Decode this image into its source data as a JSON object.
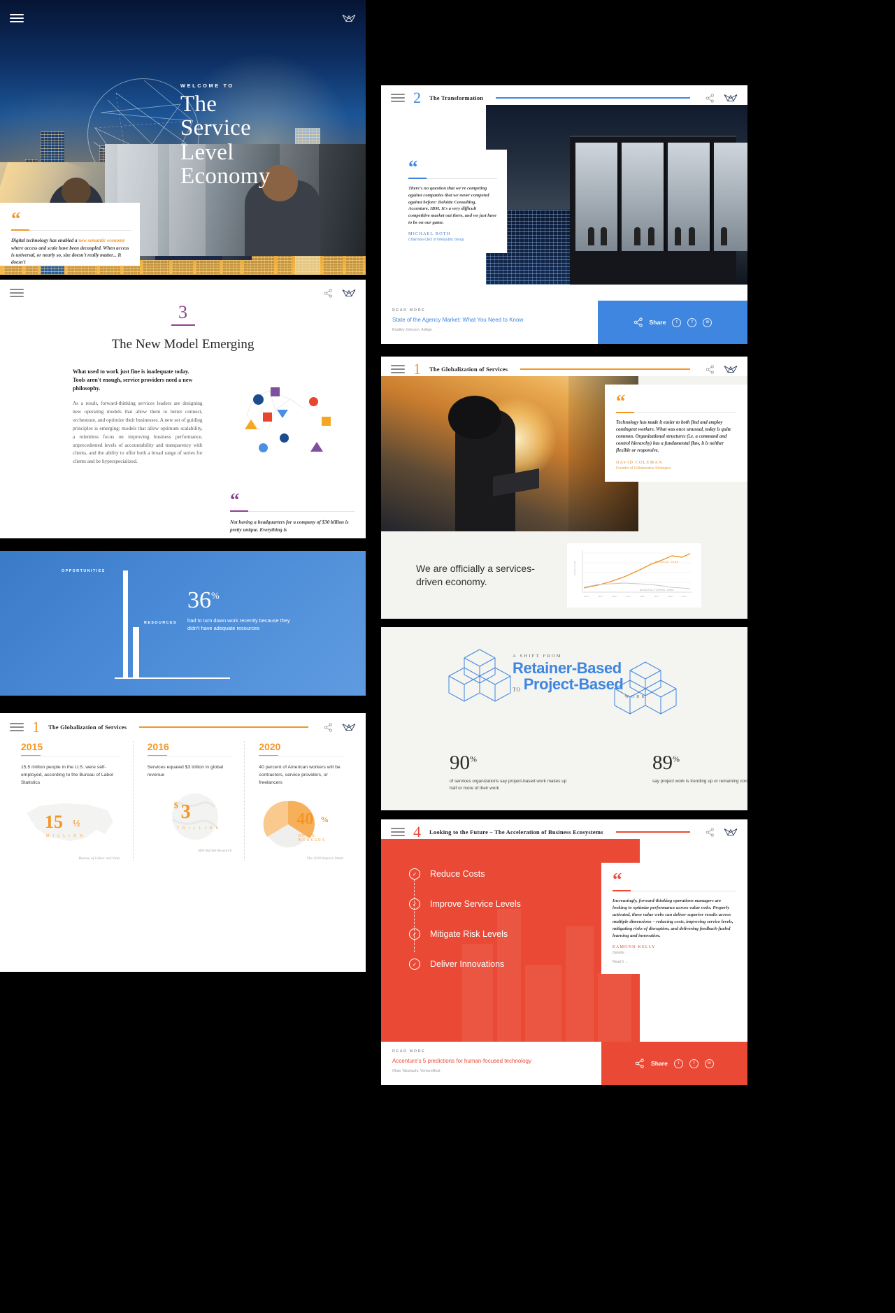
{
  "hero": {
    "welcome": "WELCOME TO",
    "title_lines": [
      "The",
      "Service",
      "Level",
      "Economy"
    ],
    "menu_icon": "hamburger-menu-icon",
    "logo_icon": "mavenlink-logo-icon"
  },
  "new_model": {
    "number": "3",
    "title": "The New Model Emerging",
    "lede": "What used to work just fine is inadequate today. Tools aren't enough, service providers need a new philosophy.",
    "body": "As a result, forward-thinking services leaders are designing new operating models that allow them to better connect, orchestrate, and optimize their businesses. A new set of guiding principles is emerging: models that allow optimum scalability, a relentless focus on improving business performance, unprecedented levels of accountability and transparency with clients, and the ability to offer both a broad range of series for clients and be hyperspecialized.",
    "accent_color": "#8e3f8e",
    "quote": "Not having a headquarters for a company of $30 billion is pretty unique. Everything is"
  },
  "blue_stat": {
    "label_opportunities": "OPPORTUNITIES",
    "label_resources": "RESOURCES",
    "value": "36",
    "unit": "%",
    "description": "had to turn down work recently because they didn't have adequate resources",
    "background_color": "#4a8ad6",
    "chart_data": {
      "type": "bar",
      "categories": [
        "OPPORTUNITIES",
        "RESOURCES"
      ],
      "values": [
        100,
        36
      ],
      "title": "",
      "xlabel": "",
      "ylabel": "",
      "ylim": [
        0,
        100
      ]
    }
  },
  "timeline": {
    "number": "1",
    "section_title": "The Globalization of Services",
    "accent_color": "#f59524",
    "columns": [
      {
        "year": "2015",
        "desc": "15.5 million people in the U.S. were self-employed, according to the Bureau of Labor Statistics",
        "viz_number": "15",
        "viz_fraction": "½",
        "viz_sub": "M I L L I O N",
        "source": "Bureau of Labor and Stats"
      },
      {
        "year": "2016",
        "desc": "Services equaled $3 trillion in global revenue",
        "viz_number": "3",
        "viz_prefix": "$",
        "viz_sub": "T R I L L I O N",
        "source": "IBA Market Research"
      },
      {
        "year": "2020",
        "desc": "40 percent of American workers will be contractors, service providers, or freelancers",
        "viz_number": "40",
        "viz_unit": "%",
        "viz_sub": "OF US WORKERS",
        "source": "The 2020 Report, Intuit"
      }
    ],
    "quote_pre": "Digital technology has enabled a ",
    "quote_highlight": "new semantic economy",
    "quote_post": " where access and scale have been decoupled. When access is universal, or nearly so, size doesn't really matter... It doesn't"
  },
  "transformation": {
    "number": "2",
    "section_title": "The Transformation",
    "accent_color": "#3f86e0",
    "quote": "There's no question that we're competing against companies that we never competed against before: Deloitte Consulting, Accenture, IBM. It's a very difficult competitive market out there, and we just have to be on our game.",
    "author": "MICHAEL ROTH",
    "author_role": "Chairman-CEO of Interpublic Group",
    "read_more_label": "READ MORE",
    "read_more_title": "State of the Agency Market: What You Need to Know",
    "read_more_sub": "Bradley Johnson, AdAge",
    "share_label": "Share",
    "share_icons": [
      "twitter-icon",
      "facebook-icon",
      "linkedin-icon"
    ]
  },
  "globalization": {
    "number": "1",
    "section_title": "The Globalization of Services",
    "accent_color": "#f59524",
    "quote": "Technology has made it easier to both find and employ contingent workers. What was once unusual, today is quite common. Organizational structures (i.e. a command and control hierarchy) has a fundamental flaw, it is neither flexible or responsive.",
    "author": "DAVID COLEMAN",
    "author_role": "Founder of Collaborative Strategies",
    "headline": "We are officially a services-driven economy.",
    "chart_data": {
      "type": "line",
      "title": "",
      "xlabel": "",
      "ylabel": "Number of Jobs",
      "x": [
        "1940",
        "1950",
        "1960",
        "1970",
        "1980",
        "1990",
        "2000",
        "2010"
      ],
      "series": [
        {
          "name": "SERVICE JOBS",
          "color": "#f0952b",
          "values": [
            12,
            18,
            25,
            36,
            50,
            66,
            84,
            98
          ]
        },
        {
          "name": "MANUFACTURING JOBS",
          "color": "#bfbfbf",
          "values": [
            14,
            20,
            22,
            24,
            22,
            20,
            16,
            12
          ]
        }
      ],
      "grid": true,
      "legend": "inline"
    }
  },
  "retainer": {
    "shift_label": "A SHIFT FROM",
    "from": "Retainer-Based",
    "to_word": "TO",
    "to": "Project-Based",
    "work_label": "WORK",
    "accent_color": "#3f86e0",
    "stats": [
      {
        "value": "90",
        "unit": "%",
        "desc": "of services organizations say project-based work makes up half or more of their work"
      },
      {
        "value": "89",
        "unit": "%",
        "desc": "say project work is trending up or remaining consistent"
      }
    ]
  },
  "future": {
    "number": "4",
    "section_title": "Looking to the Future – The Acceleration of Business Ecosystems",
    "accent_color": "#ea4a35",
    "items": [
      {
        "label": "Reduce Costs",
        "icon": "check-circle-icon"
      },
      {
        "label": "Improve Service Levels",
        "icon": "check-circle-icon"
      },
      {
        "label": "Mitigate Risk Levels",
        "icon": "check-circle-icon"
      },
      {
        "label": "Deliver Innovations",
        "icon": "check-circle-icon"
      }
    ],
    "quote": "Increasingly, forward-thinking operations managers are looking to optimize performance across value webs. Properly activated, these value webs can deliver superior results across multiple dimensions – reducing costs, improving service levels, mitigating risks of disruption, and delivering feedback-fueled learning and innovation.",
    "author": "EAMONN KELLY",
    "author_role": "Deloitte",
    "read_it": "Read it →",
    "read_more_label": "READ MORE",
    "read_more_title": "Accenture's 5 predictions for human-focused technology",
    "read_more_sub": "Okan Takahashi, VentureBeat",
    "share_label": "Share",
    "share_icons": [
      "twitter-icon",
      "facebook-icon",
      "linkedin-icon"
    ]
  }
}
